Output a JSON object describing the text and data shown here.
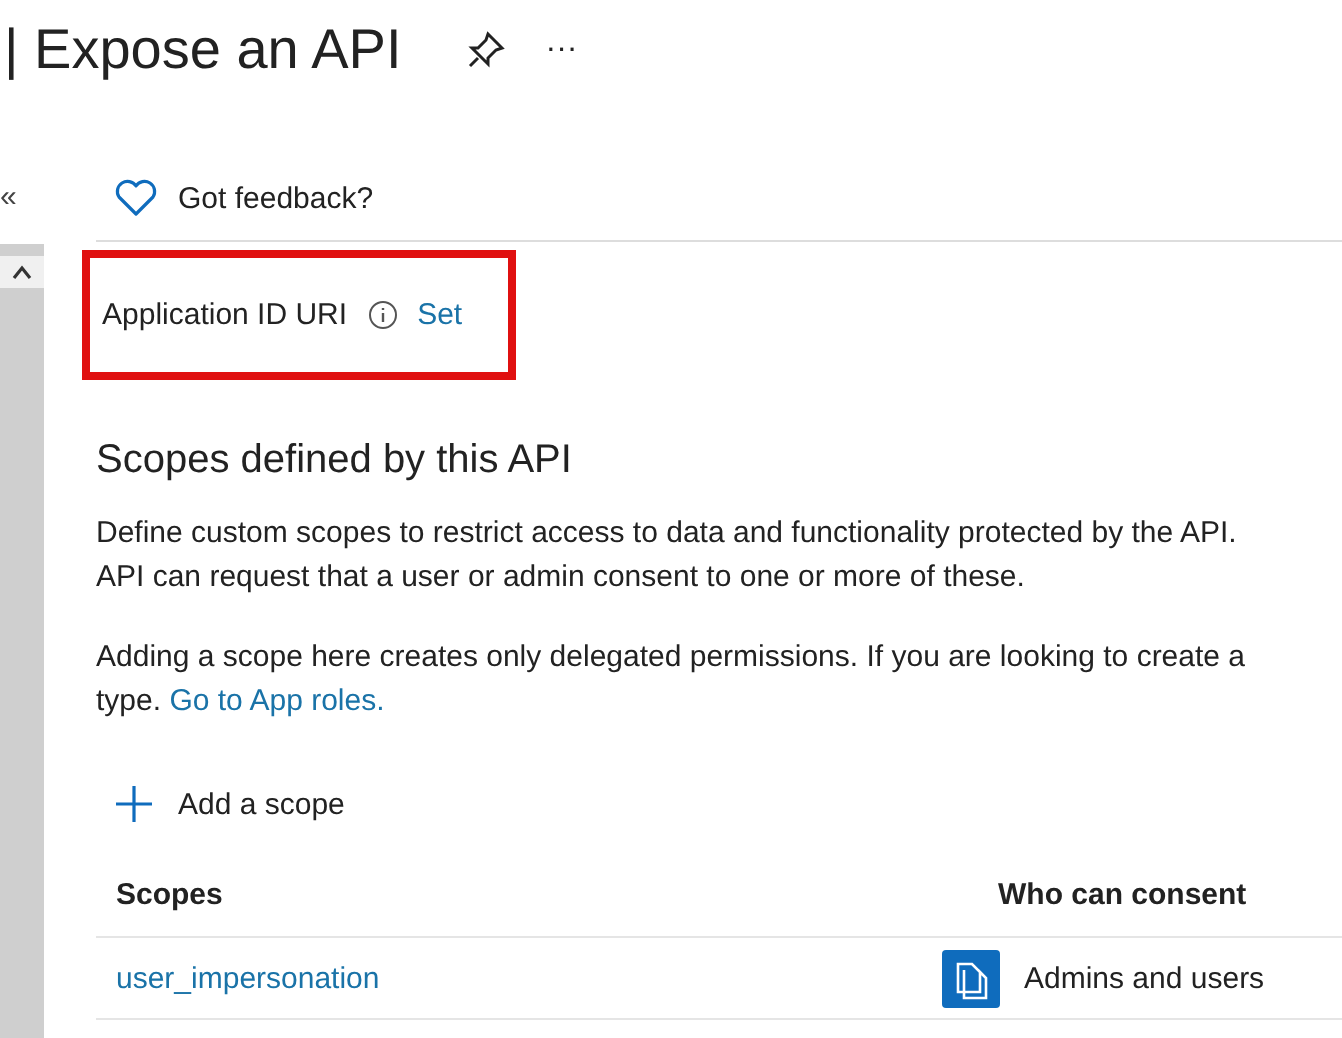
{
  "header": {
    "title": "| Expose an API",
    "more": "···"
  },
  "sidebar": {
    "collapse": "«"
  },
  "toolbar": {
    "feedback": "Got feedback?"
  },
  "app_id_uri": {
    "label": "Application ID URI",
    "action": "Set",
    "highlighted": true
  },
  "scopes_section": {
    "heading": "Scopes defined by this API",
    "intro_lines": [
      "Define custom scopes to restrict access to data and functionality protected by the API.",
      "API can request that a user or admin consent to one or more of these."
    ],
    "note_lines": [
      "Adding a scope here creates only delegated permissions. If you are looking to create a"
    ],
    "note_tail": "type.",
    "note_link": "Go to App roles.",
    "add_button": "Add a scope",
    "table": {
      "columns": [
        "Scopes",
        "Who can consent"
      ],
      "rows": [
        {
          "scope": "user_impersonation",
          "consent": "Admins and users"
        }
      ]
    }
  }
}
